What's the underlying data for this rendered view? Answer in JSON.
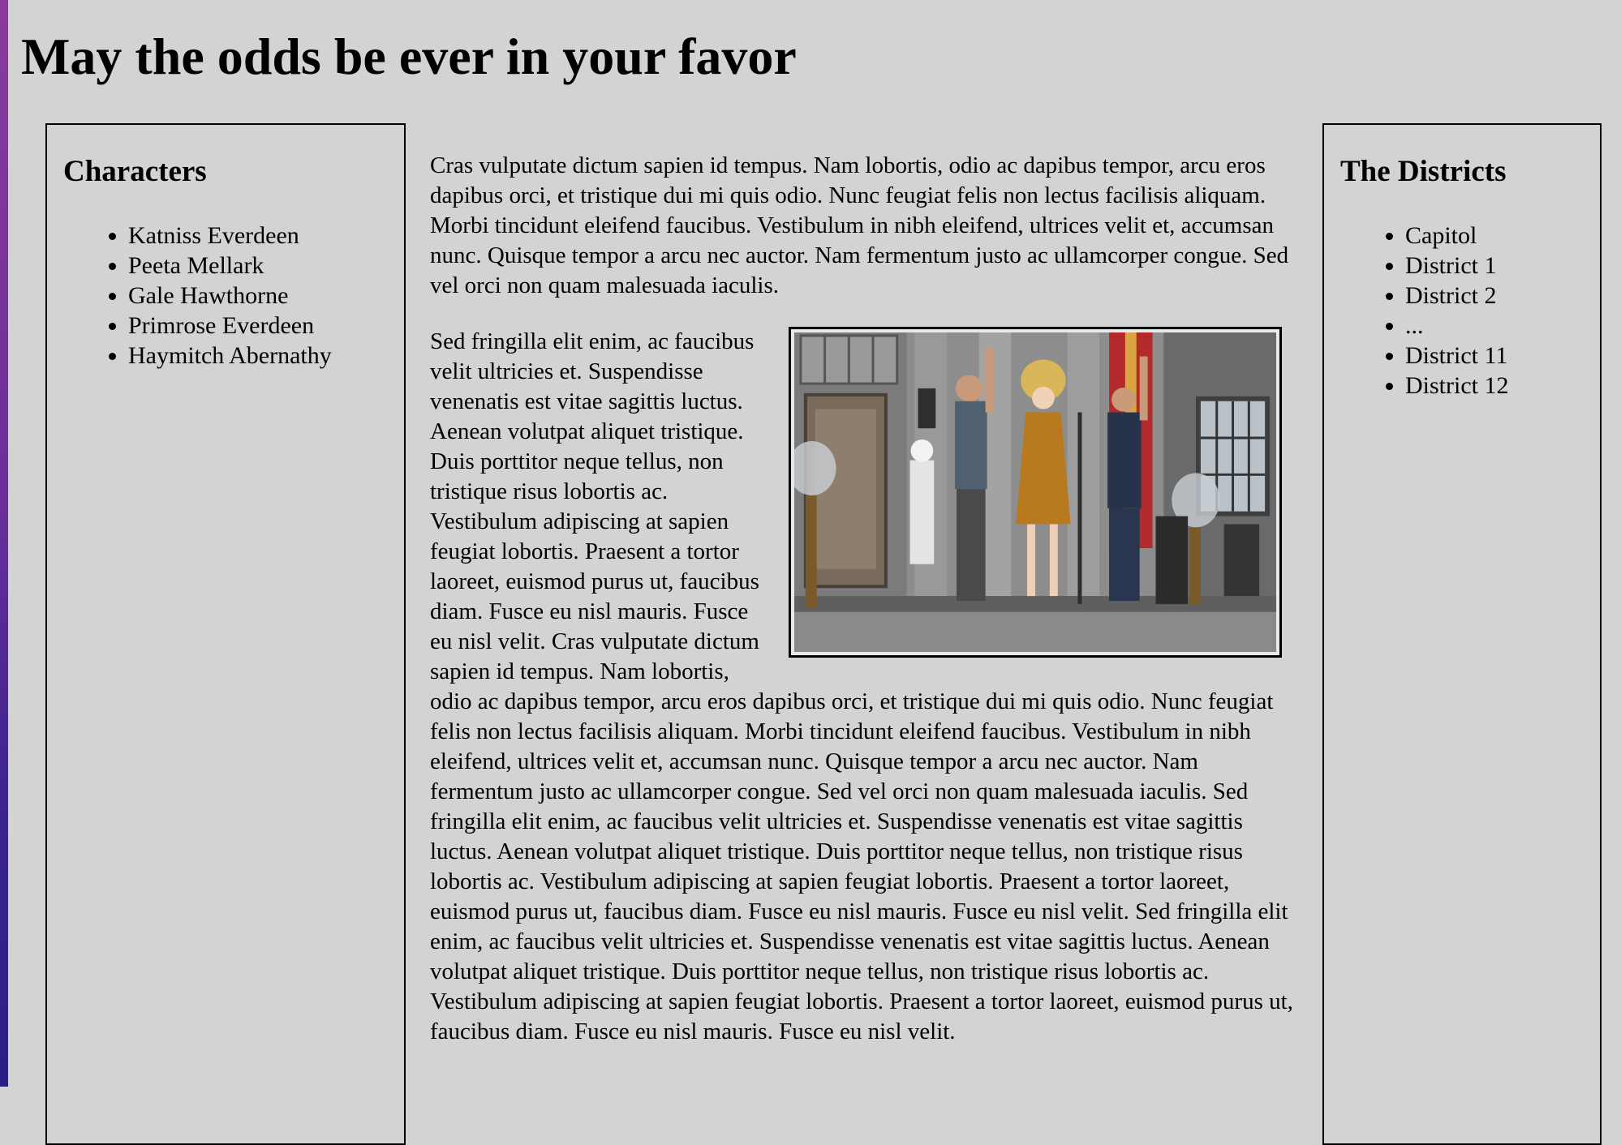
{
  "page": {
    "title": "May the odds be ever in your favor"
  },
  "left_sidebar": {
    "heading": "Characters",
    "items": [
      "Katniss Everdeen",
      "Peeta Mellark",
      "Gale Hawthorne",
      "Primrose Everdeen",
      "Haymitch Abernathy"
    ]
  },
  "right_sidebar": {
    "heading": "The Districts",
    "items": [
      "Capitol",
      "District 1",
      "District 2",
      "...",
      "District 11",
      "District 12"
    ]
  },
  "main": {
    "paragraph_1": "Cras vulputate dictum sapien id tempus. Nam lobortis, odio ac dapibus tempor, arcu eros dapibus orci, et tristique dui mi quis odio. Nunc feugiat felis non lectus facilisis aliquam. Morbi tincidunt eleifend faucibus. Vestibulum in nibh eleifend, ultrices velit et, accumsan nunc. Quisque tempor a arcu nec auctor. Nam fermentum justo ac ullamcorper congue. Sed vel orci non quam malesuada iaculis.",
    "paragraph_2": "Sed fringilla elit enim, ac faucibus velit ultricies et. Suspendisse venenatis est vitae sagittis luctus. Aenean volutpat aliquet tristique. Duis porttitor neque tellus, non tristique risus lobortis ac. Vestibulum adipiscing at sapien feugiat lobortis. Praesent a tortor laoreet, euismod purus ut, faucibus diam. Fusce eu nisl mauris. Fusce eu nisl velit. Cras vulputate dictum sapien id tempus. Nam lobortis, odio ac dapibus tempor, arcu eros dapibus orci, et tristique dui mi quis odio. Nunc feugiat felis non lectus facilisis aliquam. Morbi tincidunt eleifend faucibus. Vestibulum in nibh eleifend, ultrices velit et, accumsan nunc. Quisque tempor a arcu nec auctor. Nam fermentum justo ac ullamcorper congue. Sed vel orci non quam malesuada iaculis. Sed fringilla elit enim, ac faucibus velit ultricies et. Suspendisse venenatis est vitae sagittis luctus. Aenean volutpat aliquet tristique. Duis porttitor neque tellus, non tristique risus lobortis ac. Vestibulum adipiscing at sapien feugiat lobortis. Praesent a tortor laoreet, euismod purus ut, faucibus diam. Fusce eu nisl mauris. Fusce eu nisl velit. Sed fringilla elit enim, ac faucibus velit ultricies et. Suspendisse venenatis est vitae sagittis luctus. Aenean volutpat aliquet tristique. Duis porttitor neque tellus, non tristique risus lobortis ac. Vestibulum adipiscing at sapien feugiat lobortis. Praesent a tortor laoreet, euismod purus ut, faucibus diam. Fusce eu nisl mauris. Fusce eu nisl velit."
  },
  "colors": {
    "page_background": "#d3d3d3",
    "border": "#000000",
    "edge_strip_top": "#8a3a9c",
    "edge_strip_bottom": "#2a1e88"
  }
}
